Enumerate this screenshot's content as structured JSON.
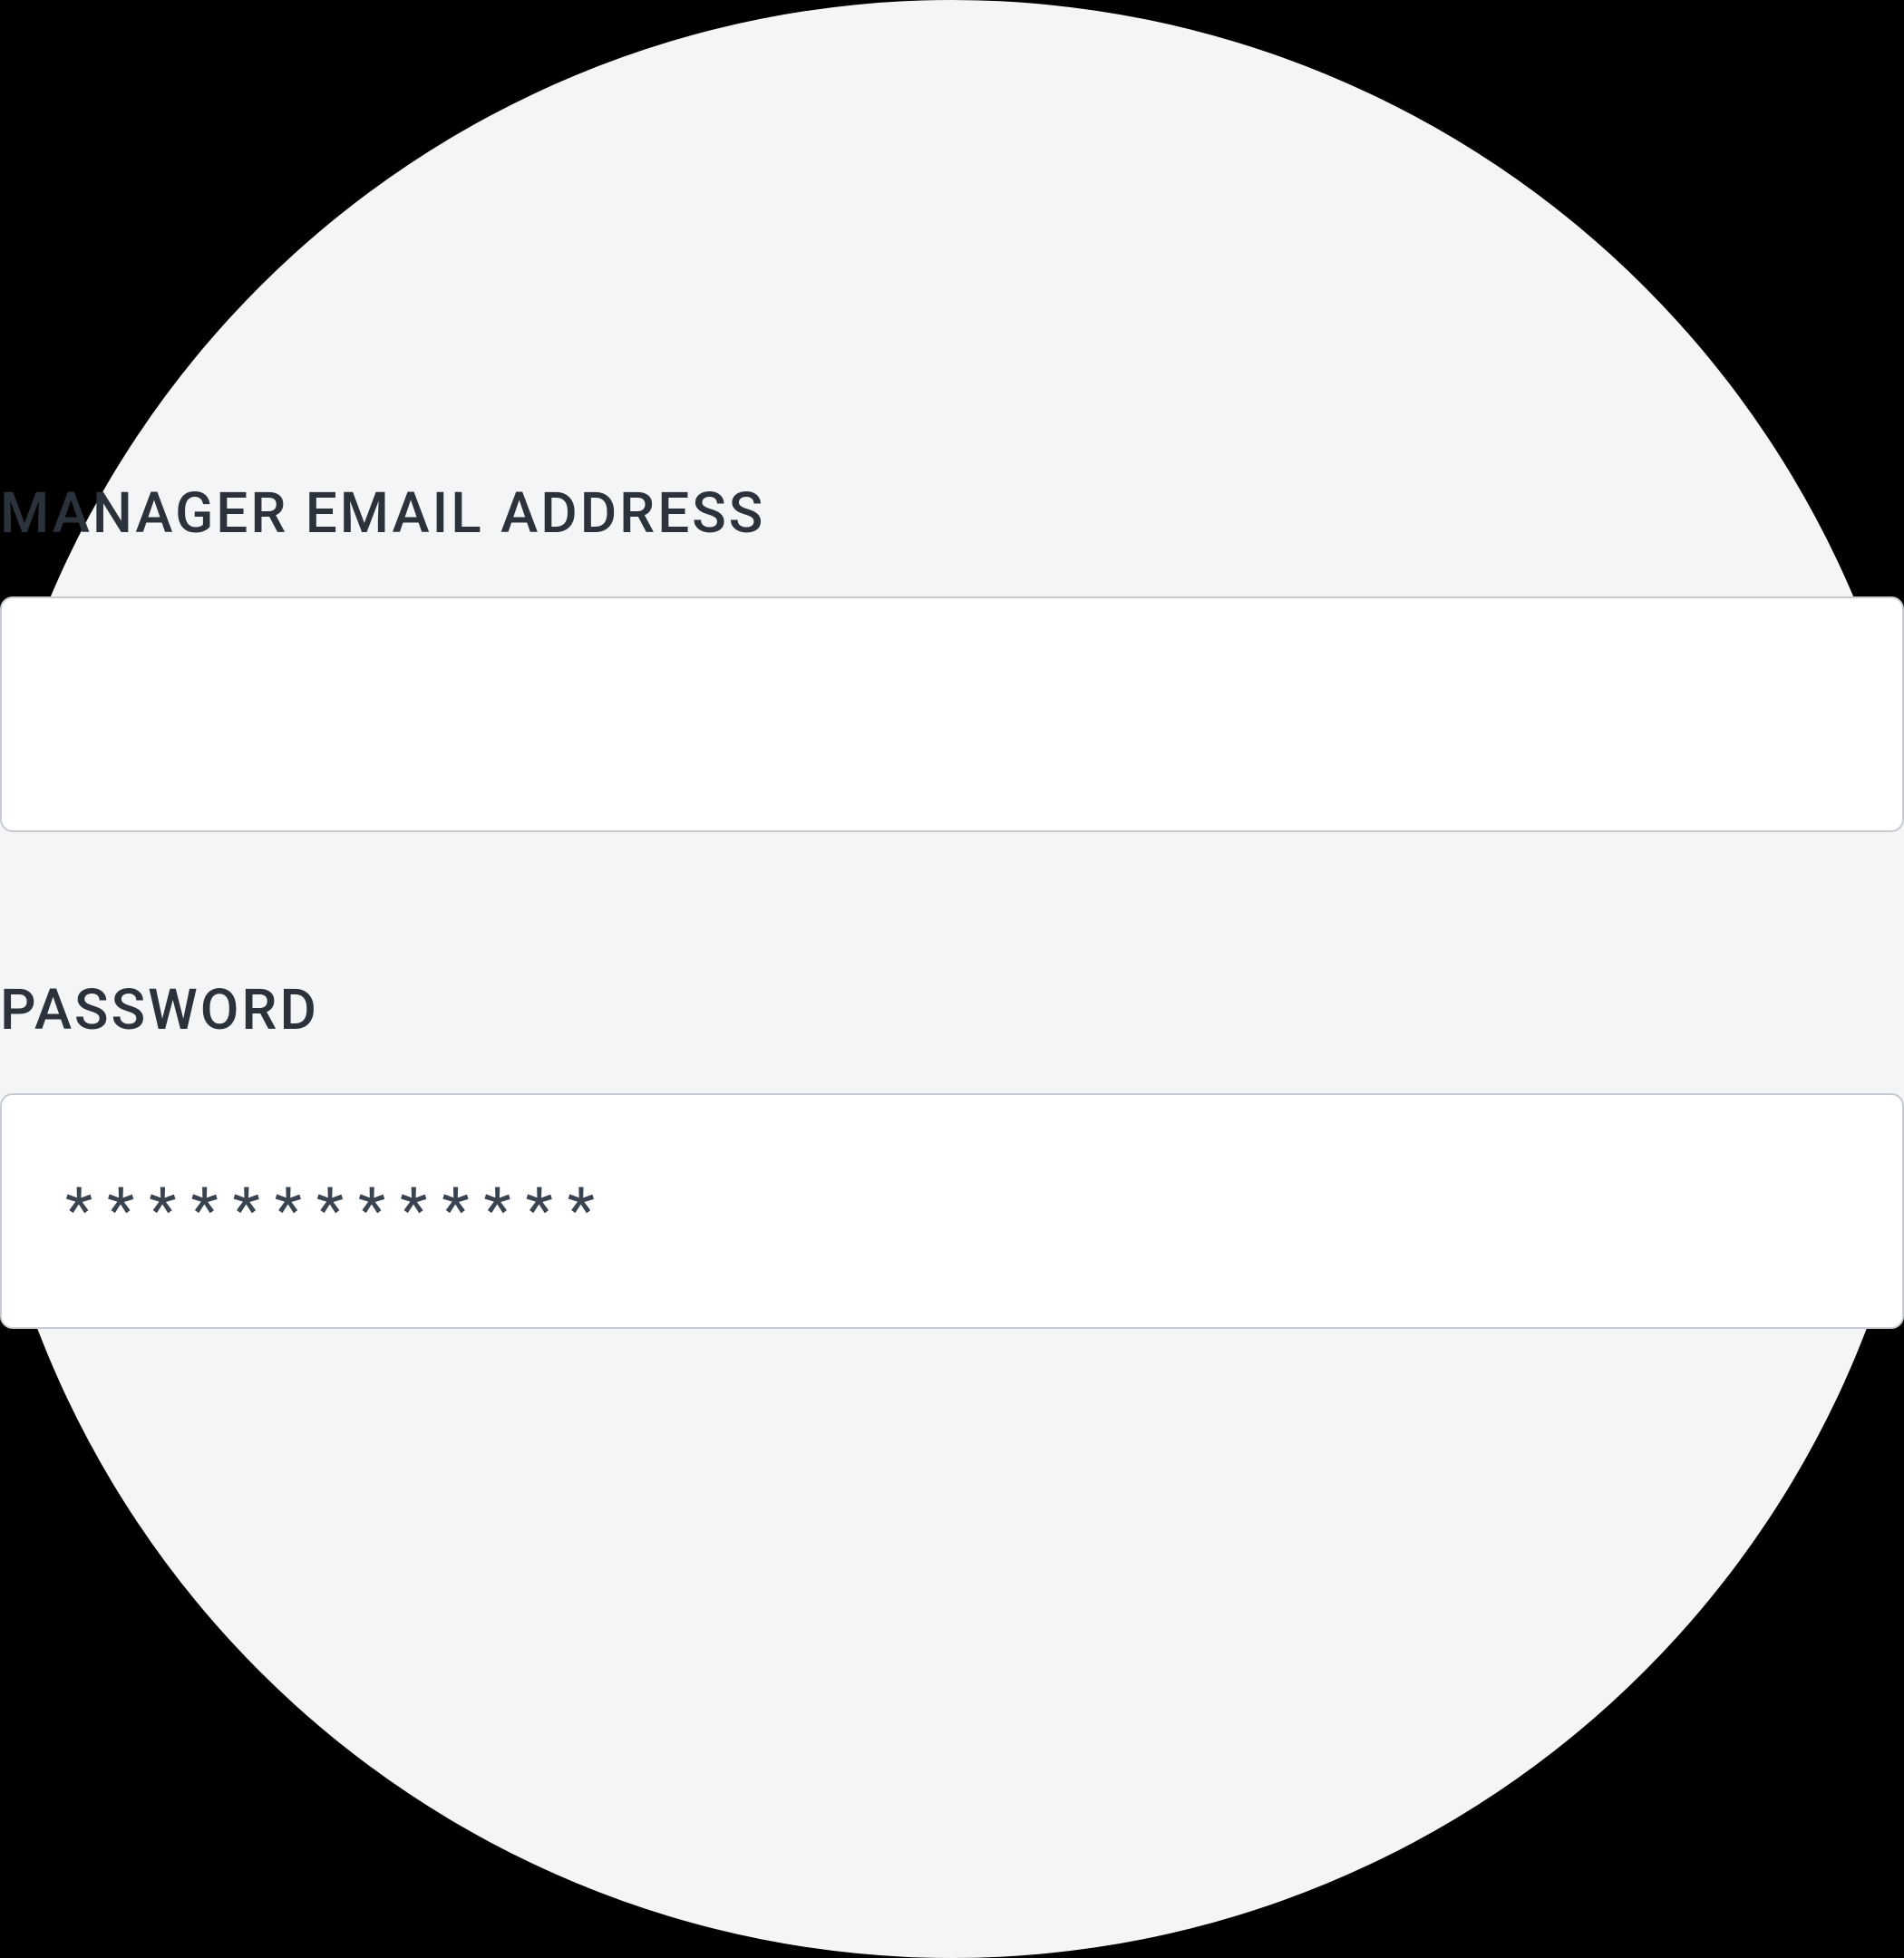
{
  "form": {
    "email": {
      "label": "MANAGER EMAIL ADDRESS",
      "value": "",
      "placeholder": ""
    },
    "password": {
      "label": "PASSWORD",
      "value": "*************",
      "placeholder": ""
    }
  }
}
